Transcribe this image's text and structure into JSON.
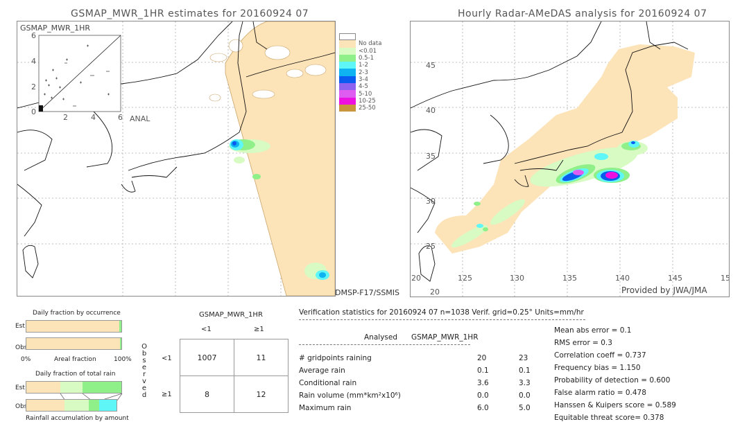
{
  "left_map": {
    "title": "GSMAP_MWR_1HR estimates for 20160924 07",
    "inset_label": "GSMAP_MWR_1HR",
    "inset_y_ticks": [
      "6",
      "4",
      "2",
      "0"
    ],
    "inset_x_ticks": [
      "2",
      "4",
      "6"
    ],
    "inset_x_label": "ANAL",
    "sensor_label": "DMSP-F17/SSMIS"
  },
  "right_map": {
    "title": "Hourly Radar-AMeDAS analysis for 20160924 07",
    "lat_ticks": [
      "45",
      "40",
      "35",
      "30",
      "25",
      "20"
    ],
    "lon_ticks": [
      "125",
      "130",
      "135",
      "140",
      "145",
      "15"
    ],
    "lon_left": "20",
    "credit": "Provided by JWA/JMA"
  },
  "legend": {
    "items": [
      {
        "label": "",
        "color": "#ffffff"
      },
      {
        "label": "No data",
        "color": "#fde3b8"
      },
      {
        "label": "<0.01",
        "color": "#d8fbc4"
      },
      {
        "label": "0.5-1",
        "color": "#8ff08a"
      },
      {
        "label": "1-2",
        "color": "#5ef6f6"
      },
      {
        "label": "2-3",
        "color": "#0fb3f2"
      },
      {
        "label": "3-4",
        "color": "#0a5cf0"
      },
      {
        "label": "4-5",
        "color": "#8d63f0"
      },
      {
        "label": "5-10",
        "color": "#df5cf0"
      },
      {
        "label": "10-25",
        "color": "#ee10e0"
      },
      {
        "label": "25-50",
        "color": "#c8963c"
      }
    ]
  },
  "fraction_charts": {
    "occurrence_title": "Daily fraction by occurrence",
    "est_label": "Est",
    "obs_label": "Obs",
    "axis_left": "0%",
    "axis_mid": "Areal fraction",
    "axis_right": "100%",
    "total_rain_title": "Daily fraction of total rain",
    "accumulation_label": "Rainfall accumulation by amount"
  },
  "contingency": {
    "title": "GSMAP_MWR_1HR",
    "col_headers": [
      "<1",
      "≥1"
    ],
    "row_headers": [
      "<1",
      "≥1"
    ],
    "observed_label": [
      "O",
      "b",
      "s",
      "e",
      "r",
      "v",
      "e",
      "d"
    ],
    "cells": [
      [
        "1007",
        "11"
      ],
      [
        "8",
        "12"
      ]
    ]
  },
  "stats": {
    "header": "Verification statistics for 20160924 07   n=1038   Verif. grid=0.25°   Units=mm/hr",
    "col_analysed": "Analysed",
    "col_gsmap": "GSMAP_MWR_1HR",
    "rows": [
      {
        "label": "# gridpoints raining",
        "analysed": "20",
        "gsmap": "23"
      },
      {
        "label": "Average rain",
        "analysed": "0.1",
        "gsmap": "0.1"
      },
      {
        "label": "Conditional rain",
        "analysed": "3.6",
        "gsmap": "3.3"
      },
      {
        "label": "Rain volume (mm*km²x10⁶)",
        "analysed": "0.0",
        "gsmap": "0.0"
      },
      {
        "label": "Maximum rain",
        "analysed": "6.0",
        "gsmap": "5.0"
      }
    ],
    "scores": [
      "Mean abs error = 0.1",
      "RMS error = 0.3",
      "Correlation coeff = 0.737",
      "Frequency bias = 1.150",
      "Probability of detection = 0.600",
      "False alarm ratio = 0.478",
      "Hanssen & Kuipers score = 0.589",
      "Equitable threat score= 0.378"
    ]
  }
}
